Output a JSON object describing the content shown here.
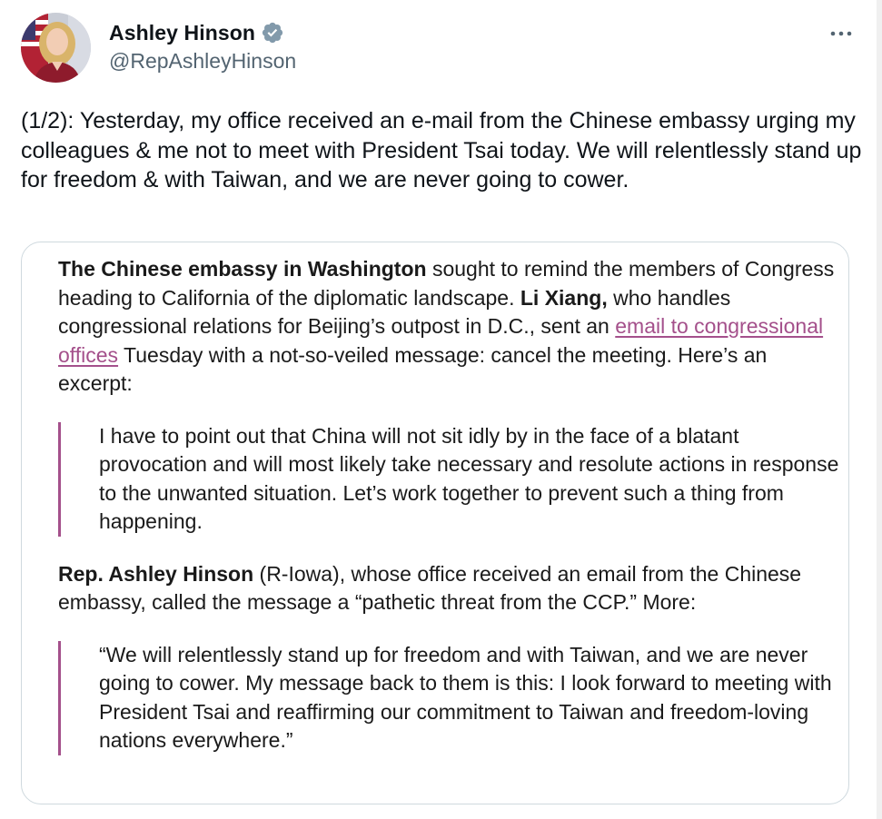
{
  "author": {
    "display_name": "Ashley Hinson",
    "handle": "@RepAshleyHinson"
  },
  "icons": {
    "verified": "verified-badge-icon",
    "more": "more-options-icon"
  },
  "colors": {
    "verified_badge": "#829aab",
    "quote_accent": "#a4508b",
    "handle_gray": "#536471"
  },
  "tweet": {
    "text": "(1/2): Yesterday, my office received an e-mail from the Chinese embassy urging my colleagues & me not to meet with President Tsai today. We will relentlessly stand up for freedom & with Taiwan, and we are never going to cower."
  },
  "quote": {
    "p1": {
      "bold1": "The Chinese embassy in Washington",
      "text1": " sought to remind the members of Congress heading to California of the diplomatic landscape. ",
      "bold2": "Li Xiang,",
      "text2": " who handles congressional relations for Beijing’s outpost in D.C., sent an ",
      "link": "email to congressional offices",
      "text3": " Tuesday with a not-so-veiled message: cancel the meeting. Here’s an excerpt:"
    },
    "blockquote1": "I have to point out that China will not sit idly by in the face of a blatant provocation and will most likely take necessary and resolute actions in response to the unwanted situation. Let’s work together to prevent such a thing from happening.",
    "p2": {
      "bold": "Rep. Ashley Hinson",
      "text": " (R-Iowa), whose office received an email from the Chinese embassy, called the message a “pathetic threat from the CCP.” More:"
    },
    "blockquote2": "“We will relentlessly stand up for freedom and with Taiwan, and we are never going to cower. My message back to them is this: I look forward to meeting with President Tsai and reaffirming our commitment to Taiwan and freedom-loving nations everywhere.”"
  }
}
